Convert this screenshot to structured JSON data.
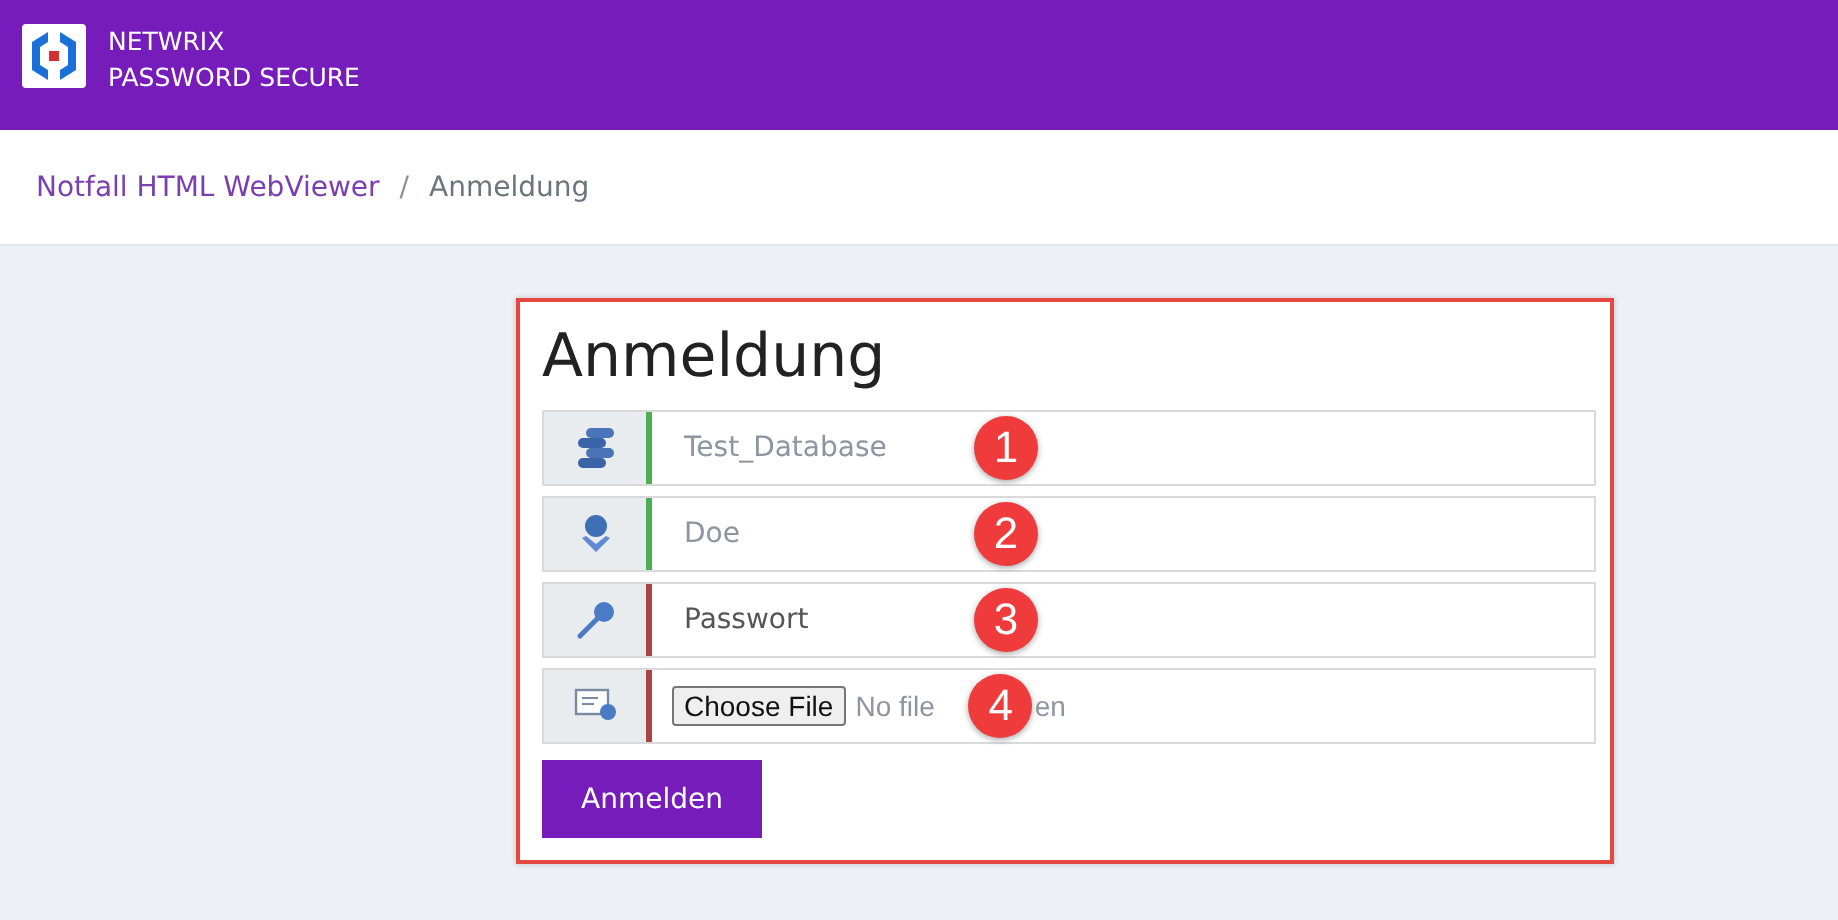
{
  "header": {
    "brand_lines": [
      "NETWRIX",
      "PASSWORD SECURE"
    ]
  },
  "breadcrumb": {
    "separator": "/",
    "items": [
      {
        "label": "Notfall HTML WebViewer",
        "link": true
      },
      {
        "label": "Anmeldung",
        "link": false
      }
    ]
  },
  "form": {
    "title": "Anmeldung",
    "rows": [
      {
        "kind": "database",
        "valid": true,
        "value": "Test_Database",
        "badge": "1"
      },
      {
        "kind": "user",
        "valid": true,
        "value": "Doe",
        "badge": "2"
      },
      {
        "kind": "password",
        "valid": false,
        "placeholder": "Passwort",
        "badge": "3"
      },
      {
        "kind": "file",
        "valid": false,
        "button": "Choose File",
        "status_text_parts": [
          "No file",
          "en"
        ],
        "badge": "4"
      }
    ],
    "submit": "Anmelden"
  }
}
